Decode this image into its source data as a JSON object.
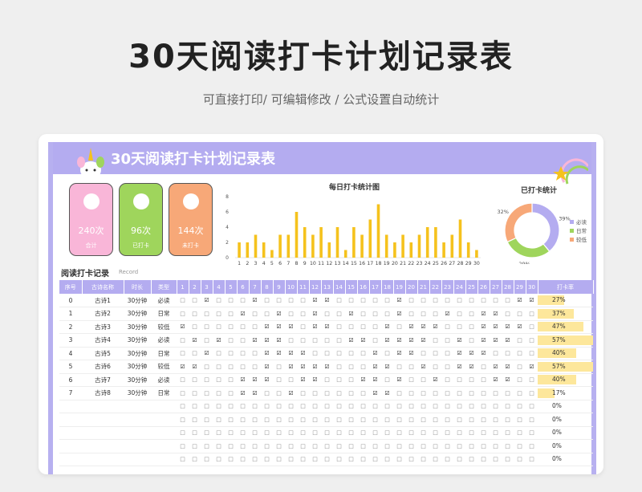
{
  "header": {
    "title": "30天阅读打卡计划记录表",
    "subtitle": "可直接打印/  可编辑修改  / 公式设置自动统计"
  },
  "sheet": {
    "banner_title": "30天阅读打卡计划记录表"
  },
  "stats": [
    {
      "value": "240次",
      "label": "合计",
      "color": "#f9b6d8"
    },
    {
      "value": "96次",
      "label": "已打卡",
      "color": "#9fd55c"
    },
    {
      "value": "144次",
      "label": "未打卡",
      "color": "#f7a878"
    }
  ],
  "bar_chart": {
    "title": "每日打卡统计图",
    "days": [
      "1",
      "2",
      "3",
      "4",
      "5",
      "6",
      "7",
      "8",
      "9",
      "10",
      "11",
      "12",
      "13",
      "14",
      "15",
      "16",
      "17",
      "18",
      "19",
      "20",
      "21",
      "22",
      "23",
      "24",
      "25",
      "26",
      "27",
      "28",
      "29",
      "30"
    ],
    "values": [
      2,
      2,
      3,
      2,
      1,
      3,
      3,
      6,
      4,
      3,
      4,
      2,
      4,
      1,
      4,
      3,
      5,
      7,
      3,
      2,
      3,
      2,
      3,
      4,
      4,
      2,
      3,
      5,
      2,
      1
    ],
    "ylim": [
      0,
      8
    ],
    "yticks": [
      "0",
      "2",
      "4",
      "6",
      "8"
    ],
    "color": "#f5c21d"
  },
  "donut": {
    "title": "已打卡统计",
    "slices": [
      {
        "name": "必读",
        "value": 39,
        "label": "39%",
        "color": "#b4acf0"
      },
      {
        "name": "日常",
        "value": 29,
        "label": "29%",
        "color": "#9fd55c"
      },
      {
        "name": "较低",
        "value": 32,
        "label": "32%",
        "color": "#f7a878"
      }
    ]
  },
  "record": {
    "label": "阅读打卡记录",
    "sub": "Record"
  },
  "table": {
    "headers": [
      "序号",
      "古诗名称",
      "时长",
      "类型",
      "1",
      "2",
      "3",
      "4",
      "5",
      "6",
      "7",
      "8",
      "9",
      "10",
      "11",
      "12",
      "13",
      "14",
      "15",
      "16",
      "17",
      "18",
      "19",
      "20",
      "21",
      "22",
      "23",
      "24",
      "25",
      "26",
      "27",
      "28",
      "29",
      "30",
      "打卡率"
    ],
    "checked_symbol": "☑",
    "unchecked_symbol": "□",
    "rows": [
      {
        "no": "0",
        "name": "古诗1",
        "duration": "30分钟",
        "type": "必读",
        "checks": "001000100001100000100000000011",
        "rate": "27%",
        "rate_value": 27
      },
      {
        "no": "1",
        "name": "古诗2",
        "duration": "30分钟",
        "type": "日常",
        "checks": "000001001001001000100010011000",
        "rate": "37%",
        "rate_value": 37
      },
      {
        "no": "2",
        "name": "古诗3",
        "duration": "30分钟",
        "type": "较低",
        "checks": "100000011101100001011100011110",
        "rate": "47%",
        "rate_value": 47
      },
      {
        "no": "3",
        "name": "古诗4",
        "duration": "30分钟",
        "type": "必读",
        "checks": "010100111000001101111001011100",
        "rate": "57%",
        "rate_value": 57
      },
      {
        "no": "4",
        "name": "古诗5",
        "duration": "30分钟",
        "type": "日常",
        "checks": "001000011110000010110001110000",
        "rate": "40%",
        "rate_value": 40
      },
      {
        "no": "5",
        "name": "古诗6",
        "duration": "30分钟",
        "type": "较低",
        "checks": "110000010111100011001001101101",
        "rate": "57%",
        "rate_value": 57
      },
      {
        "no": "6",
        "name": "古诗7",
        "duration": "30分钟",
        "type": "必读",
        "checks": "000001110011000110100100001100",
        "rate": "40%",
        "rate_value": 40
      },
      {
        "no": "7",
        "name": "古诗8",
        "duration": "30分钟",
        "type": "日常",
        "checks": "000001100100000011000000000000",
        "rate": "17%",
        "rate_value": 17
      },
      {
        "no": "",
        "name": "",
        "duration": "",
        "type": "",
        "checks": "000000000000000000000000000000",
        "rate": "0%",
        "rate_value": 0
      },
      {
        "no": "",
        "name": "",
        "duration": "",
        "type": "",
        "checks": "000000000000000000000000000000",
        "rate": "0%",
        "rate_value": 0
      },
      {
        "no": "",
        "name": "",
        "duration": "",
        "type": "",
        "checks": "000000000000000000000000000000",
        "rate": "0%",
        "rate_value": 0
      },
      {
        "no": "",
        "name": "",
        "duration": "",
        "type": "",
        "checks": "000000000000000000000000000000",
        "rate": "0%",
        "rate_value": 0
      },
      {
        "no": "",
        "name": "",
        "duration": "",
        "type": "",
        "checks": "000000000000000000000000000000",
        "rate": "0%",
        "rate_value": 0
      }
    ]
  }
}
